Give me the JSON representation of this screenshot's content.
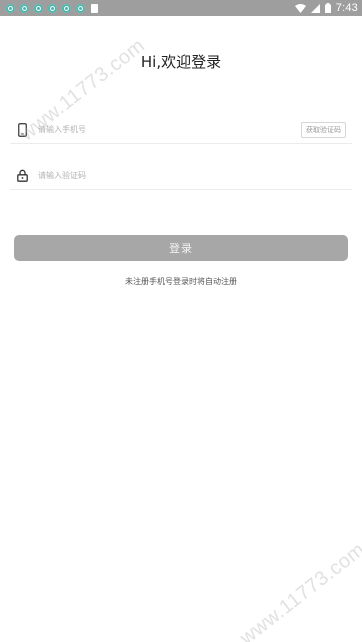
{
  "status_bar": {
    "time": "7:43",
    "notification_icons": [
      "app-icon",
      "app-icon",
      "app-icon",
      "app-icon",
      "app-icon",
      "app-icon",
      "document-icon"
    ],
    "status_icons": [
      "wifi-icon",
      "signal-icon",
      "battery-icon"
    ]
  },
  "title": "Hi,欢迎登录",
  "phone_field": {
    "placeholder": "请输入手机号",
    "icon": "phone-icon",
    "get_code_label": "获取验证码"
  },
  "code_field": {
    "placeholder": "请输入验证码",
    "icon": "lock-icon"
  },
  "login_button": {
    "label": "登录"
  },
  "hint": "未注册手机号登录时将自动注册",
  "watermark": "www.11773.com",
  "colors": {
    "status_bar": "#9e9e9e",
    "login_button_disabled": "#a7a7a7",
    "notification_accent": "#4db6ac"
  }
}
